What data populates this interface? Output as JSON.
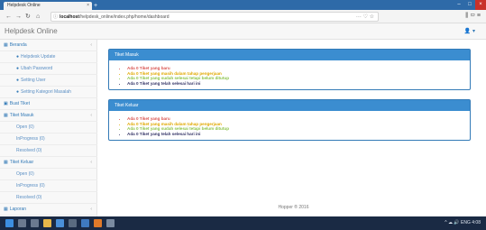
{
  "browser": {
    "tab_title": "Helpdesk Online",
    "tab_close": "×",
    "new_tab": "+",
    "url_host": "localhost",
    "url_path": "/helpdesk_online/index.php/home/dashboard",
    "url_actions": "··· ♡ ☆",
    "right_tools": "⫼ ▭ ≡",
    "window_buttons": [
      "–",
      "□",
      "×"
    ]
  },
  "nav": {
    "back": "←",
    "forward": "→",
    "reload": "↻",
    "home": "⌂",
    "lock": "ⓘ"
  },
  "app": {
    "brand": "Helpdesk Online",
    "user_menu": "👤 ▾"
  },
  "sidebar": {
    "items": [
      {
        "label": "Beranda",
        "icon": "▦",
        "caret": "‹"
      },
      {
        "label": "Helpdesk Update",
        "icon": "●",
        "sub": true
      },
      {
        "label": "Ubah Password",
        "icon": "●",
        "sub": true
      },
      {
        "label": "Setting User",
        "icon": "●",
        "sub": true
      },
      {
        "label": "Setting Kategori Masalah",
        "icon": "●",
        "sub": true
      },
      {
        "label": "Buat Tiket",
        "icon": "▣"
      },
      {
        "label": "Tiket Masuk",
        "icon": "▦",
        "caret": "‹"
      },
      {
        "label": "Open (0)",
        "sub": true
      },
      {
        "label": "InProgress (0)",
        "sub": true
      },
      {
        "label": "Resolved (0)",
        "sub": true
      },
      {
        "label": "Tiket Keluar",
        "icon": "▦",
        "caret": "‹"
      },
      {
        "label": "Open (0)",
        "sub": true
      },
      {
        "label": "InProgress (0)",
        "sub": true
      },
      {
        "label": "Resolved (0)",
        "sub": true
      },
      {
        "label": "Laporan",
        "icon": "▦",
        "caret": "‹"
      }
    ]
  },
  "panels": [
    {
      "title": "Tiket Masuk",
      "lines": [
        {
          "text": "Ada 0 Tiket yang baru",
          "color": "#d9534f"
        },
        {
          "text": "Ada 0 Tiket yang masih dalam tahap pengerjaan",
          "color": "#e0a800"
        },
        {
          "text": "Ada 0 Tiket yang sudah selesai tetapi belum ditutup",
          "color": "#8bc34a"
        },
        {
          "text": "Ada 0 Tiket yang telah selesai hari ini",
          "color": "#333366"
        }
      ]
    },
    {
      "title": "Tiket Keluar",
      "lines": [
        {
          "text": "Ada 0 Tiket yang baru",
          "color": "#d9534f"
        },
        {
          "text": "Ada 0 Tiket yang masih dalam tahap pengerjaan",
          "color": "#e0a800"
        },
        {
          "text": "Ada 0 Tiket yang sudah selesai tetapi belum ditutup",
          "color": "#8bc34a"
        },
        {
          "text": "Ada 0 Tiket yang telah selesai hari ini",
          "color": "#333366"
        }
      ]
    }
  ],
  "footer": "Hopper ® 2016",
  "taskbar": {
    "tray": "^ ☁ 🔊 ENG 4:08",
    "icons": [
      "windows-start-icon",
      "search-icon",
      "task-view-icon",
      "file-explorer-icon",
      "browser-icon",
      "store-icon",
      "mail-icon",
      "firefox-icon",
      "app-icon"
    ]
  },
  "colors": {
    "accent": "#337ab7",
    "panel_header": "#3b8dd0",
    "titlebar": "#2e6aa8",
    "taskbar": "#1a2a44"
  }
}
